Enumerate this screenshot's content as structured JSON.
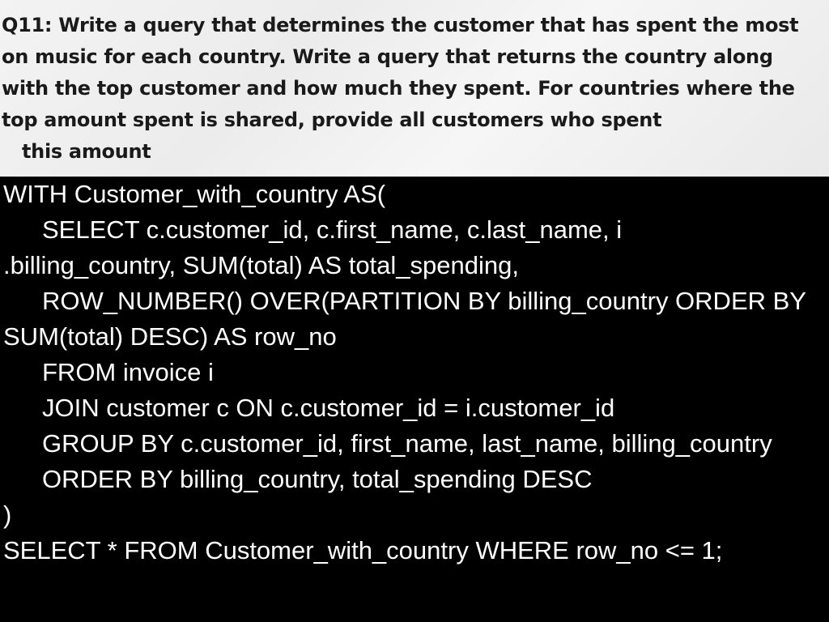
{
  "question": {
    "lines": [
      "Q11: Write a query that determines the customer that has spent the most",
      "on music for each country. Write a query that returns the country along",
      "with the top customer and how much they spent. For countries where the",
      "top amount spent is shared, provide all customers who spent",
      "this amount"
    ]
  },
  "code": {
    "lines": [
      "WITH Customer_with_country AS(",
      "SELECT c.customer_id, c.first_name, c.last_name, i",
      ".billing_country, SUM(total) AS total_spending,",
      "ROW_NUMBER() OVER(PARTITION BY billing_country ORDER BY",
      "SUM(total) DESC) AS row_no",
      "FROM invoice i",
      "JOIN customer c ON c.customer_id = i.customer_id",
      "GROUP BY c.customer_id, first_name, last_name, billing_country",
      "ORDER BY billing_country, total_spending DESC",
      ")",
      "SELECT * FROM Customer_with_country WHERE row_no <= 1;"
    ]
  },
  "colors": {
    "question_bg": "#f1f1f1",
    "question_text": "#1a1a1a",
    "code_bg": "#000000",
    "code_text": "#ffffff"
  }
}
